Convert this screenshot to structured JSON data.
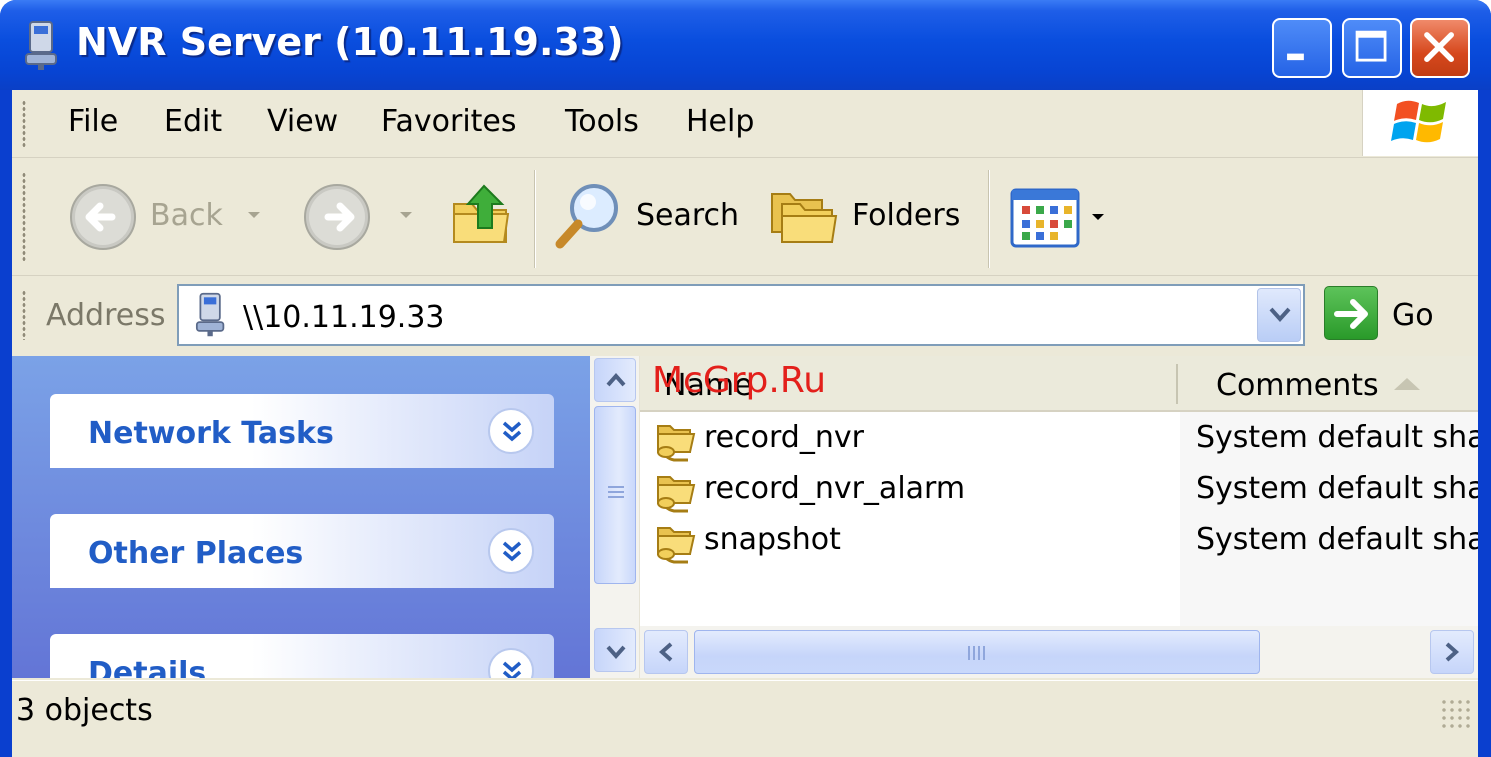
{
  "window": {
    "title": "NVR Server (10.11.19.33)",
    "minimize_icon": "minimize-icon",
    "maximize_icon": "maximize-icon",
    "close_icon": "close-icon"
  },
  "menu": {
    "items": [
      {
        "label": "File"
      },
      {
        "label": "Edit"
      },
      {
        "label": "View"
      },
      {
        "label": "Favorites"
      },
      {
        "label": "Tools"
      },
      {
        "label": "Help"
      }
    ],
    "logo_icon": "windows-logo-icon"
  },
  "toolbar": {
    "back_label": "Back",
    "search_label": "Search",
    "folders_label": "Folders",
    "views_icon": "views-icon"
  },
  "address": {
    "label": "Address",
    "value": "\\\\10.11.19.33",
    "go_label": "Go"
  },
  "taskpane": {
    "sections": [
      {
        "title": "Network Tasks"
      },
      {
        "title": "Other Places"
      },
      {
        "title": "Details"
      }
    ]
  },
  "files": {
    "columns": [
      "Name",
      "Comments"
    ],
    "rows": [
      {
        "name": "record_nvr",
        "comment": "System default sha"
      },
      {
        "name": "record_nvr_alarm",
        "comment": "System default sha"
      },
      {
        "name": "snapshot",
        "comment": "System default sha"
      }
    ]
  },
  "status": {
    "text": "3 objects"
  },
  "watermark": "McGrp.Ru",
  "colors": {
    "titlebar": "#0a4ede",
    "taskpane_top": "#7ba2e7",
    "taskpane_bottom": "#6375d6",
    "task_title": "#215dc6",
    "chrome": "#ece9d8",
    "watermark": "#e3201b"
  }
}
